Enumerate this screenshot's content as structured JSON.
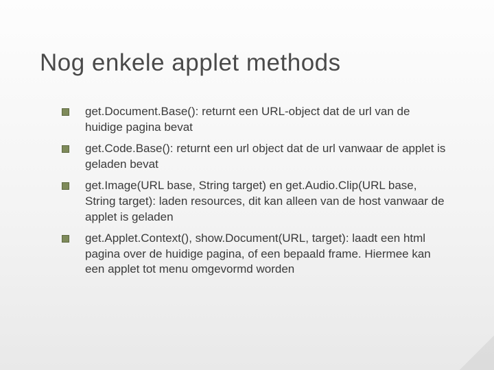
{
  "title": "Nog enkele applet methods",
  "bullets": [
    {
      "text": "get.Document.Base(): returnt een URL-object dat de url van de huidige pagina bevat"
    },
    {
      "text": "get.Code.Base(): returnt een url object dat de url vanwaar de applet is geladen bevat"
    },
    {
      "text": "get.Image(URL base, String target) en get.Audio.Clip(URL base, String target): laden resources, dit kan alleen van de host vanwaar de applet is geladen"
    },
    {
      "text": "get.Applet.Context(), show.Document(URL, target): laadt een html pagina over de huidige pagina, of een bepaald frame. Hiermee kan een applet tot menu omgevormd worden"
    }
  ]
}
